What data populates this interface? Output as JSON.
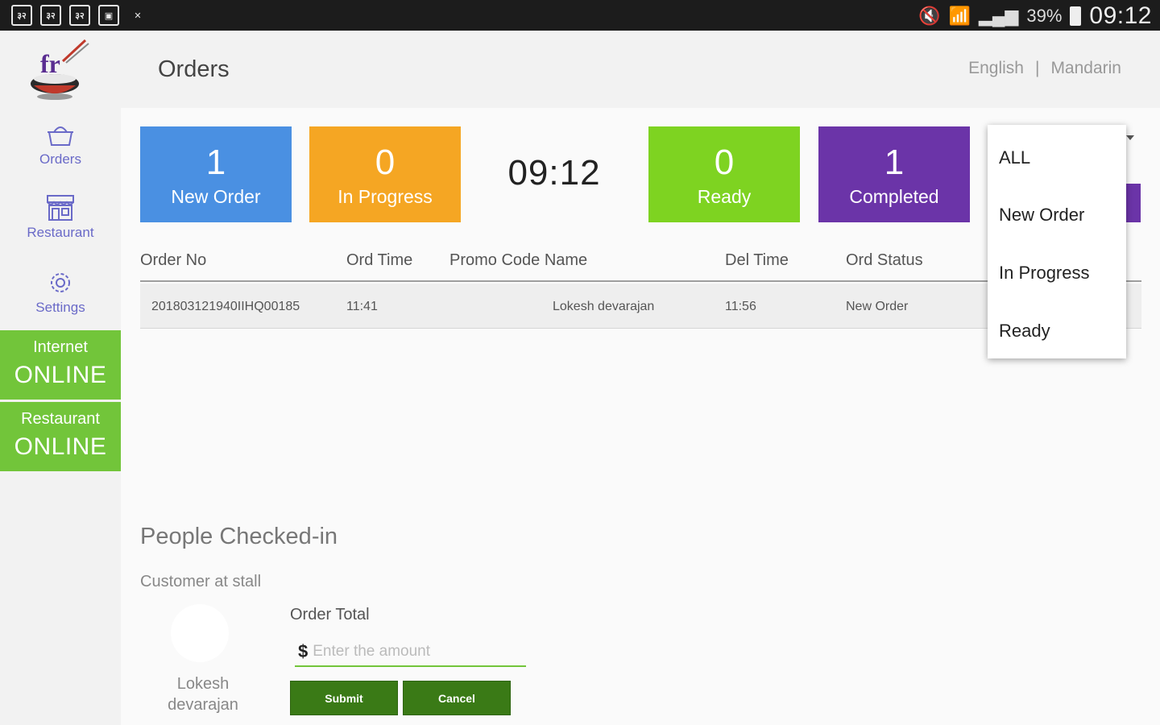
{
  "status_bar": {
    "left_icons": [
      "notification-icon-1",
      "notification-icon-2",
      "notification-icon-3",
      "image-icon",
      "document-icon"
    ],
    "left_icon_glyphs": [
      "३२",
      "३२",
      "३२",
      "▣",
      "✕"
    ],
    "mute_glyph": "🔇",
    "wifi_glyph": "📶",
    "signal_glyph": "▂▄▆",
    "battery": "39%",
    "time": "09:12"
  },
  "sidebar": {
    "nav": [
      {
        "label": "Orders",
        "icon": "basket-icon"
      },
      {
        "label": "Restaurant",
        "icon": "storefront-icon"
      },
      {
        "label": "Settings",
        "icon": "gear-icon"
      }
    ],
    "internet": {
      "label": "Internet",
      "value": "ONLINE"
    },
    "restaurant": {
      "label": "Restaurant",
      "value": "ONLINE"
    }
  },
  "header": {
    "title": "Orders",
    "languages": [
      "English",
      "Mandarin"
    ],
    "separator": "|"
  },
  "summary": {
    "cards": [
      {
        "count": "1",
        "label": "New Order",
        "color": "#4a90e2"
      },
      {
        "count": "0",
        "label": "In Progress",
        "color": "#f5a623"
      },
      {
        "count": "0",
        "label": "Ready",
        "color": "#7ed321"
      },
      {
        "count": "1",
        "label": "Completed",
        "color": "#6b34a8"
      }
    ],
    "clock": "09:12"
  },
  "table": {
    "columns": [
      "Order No",
      "Ord Time",
      "Promo Code Name",
      "Del Time",
      "Ord Status"
    ],
    "rows": [
      {
        "order_no": "201803121940IIHQ00185",
        "ord_time": "11:41",
        "name": "Lokesh devarajan",
        "del_time": "11:56",
        "status": "New Order"
      }
    ]
  },
  "status_filter": {
    "options": [
      "ALL",
      "New Order",
      "In Progress",
      "Ready"
    ]
  },
  "checkin": {
    "title": "People Checked-in",
    "subtitle": "Customer at stall",
    "customer_first": "Lokesh",
    "customer_last": "devarajan",
    "order_total_label": "Order Total",
    "currency": "$",
    "amount_placeholder": "Enter the amount",
    "submit_label": "Submit",
    "cancel_label": "Cancel"
  },
  "colors": {
    "accent_green": "#72c53a",
    "button_green": "#3a7a16",
    "nav_purple": "#6a6ac8"
  }
}
